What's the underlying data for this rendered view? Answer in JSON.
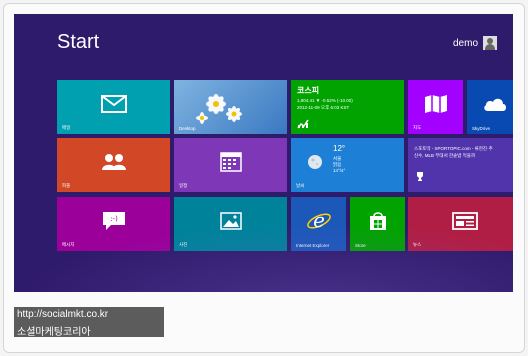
{
  "screen": {
    "title": "Start",
    "user_name": "demo"
  },
  "tiles": {
    "mail": {
      "label": "메일",
      "icon": "mail-icon"
    },
    "desktop": {
      "label": "Desktop",
      "icon": "daisy-wallpaper"
    },
    "kospi": {
      "title": "코스피",
      "line1": "1,904.41  ▼ -0.52% (-10.00)",
      "line2": "2012-11-09 오후 6:03 KST",
      "icon": "finance-chart-icon"
    },
    "maps": {
      "label": "지도",
      "icon": "map-icon"
    },
    "skydrive": {
      "label": "SkyDrive",
      "icon": "cloud-icon"
    },
    "people": {
      "label": "피플",
      "icon": "people-icon"
    },
    "calendar": {
      "label": "일정",
      "icon": "calendar-icon"
    },
    "weather": {
      "label": "날씨",
      "temp": "12°",
      "city": "서울",
      "cond": "맑음",
      "range": "14°/4°",
      "icon": "moon-icon"
    },
    "sports": {
      "line1": "스포토막 - SPORTOPIC.com - 류현진·추",
      "line2": "신수, MLB 무대서 한솥밥 먹을까",
      "icon": "trophy-icon"
    },
    "messaging": {
      "label": "메시지",
      "icon": "chat-bubble-icon"
    },
    "photos": {
      "label": "사진",
      "icon": "photo-icon"
    },
    "ie": {
      "label": "Internet Explorer",
      "icon": "ie-logo-icon"
    },
    "store": {
      "label": "Store",
      "icon": "store-bag-icon"
    },
    "news": {
      "label": "뉴스",
      "icon": "newspaper-icon"
    }
  },
  "caption": {
    "url": "http://socialmkt.co.kr",
    "name": "소셜마케팅코리아"
  }
}
